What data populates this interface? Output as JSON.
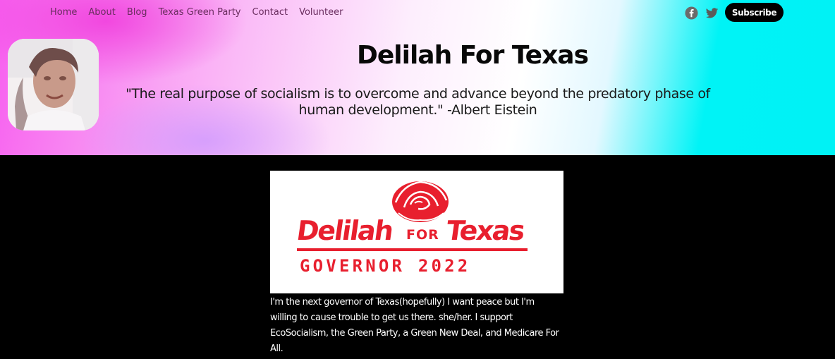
{
  "nav": {
    "items": [
      {
        "label": "Home"
      },
      {
        "label": "About"
      },
      {
        "label": "Blog"
      },
      {
        "label": "Texas Green Party"
      },
      {
        "label": "Contact"
      },
      {
        "label": "Volunteer"
      }
    ]
  },
  "social": {
    "icons": [
      "facebook-icon",
      "twitter-icon"
    ],
    "subscribe_label": "Subscribe"
  },
  "header": {
    "title": "Delilah For Texas",
    "quote": "\"The real purpose of socialism is to overcome and advance beyond the predatory phase of human development.\" -Albert Eistein"
  },
  "logo": {
    "name_left": "Delilah",
    "name_mid": "FOR",
    "name_right": "Texas",
    "tagline": "GOVERNOR 2022",
    "color": "#e81f2e"
  },
  "bio": {
    "text": "I'm the next governor of Texas(hopefully) I want peace but I'm willing to cause trouble to get us there. she/her. I support EcoSocialism, the Green Party, a Green New Deal, and Medicare For All."
  },
  "colors": {
    "nav_text": "#6a2d5f",
    "gradient_pink": "#f760ef",
    "gradient_cyan": "#00f2f5"
  }
}
